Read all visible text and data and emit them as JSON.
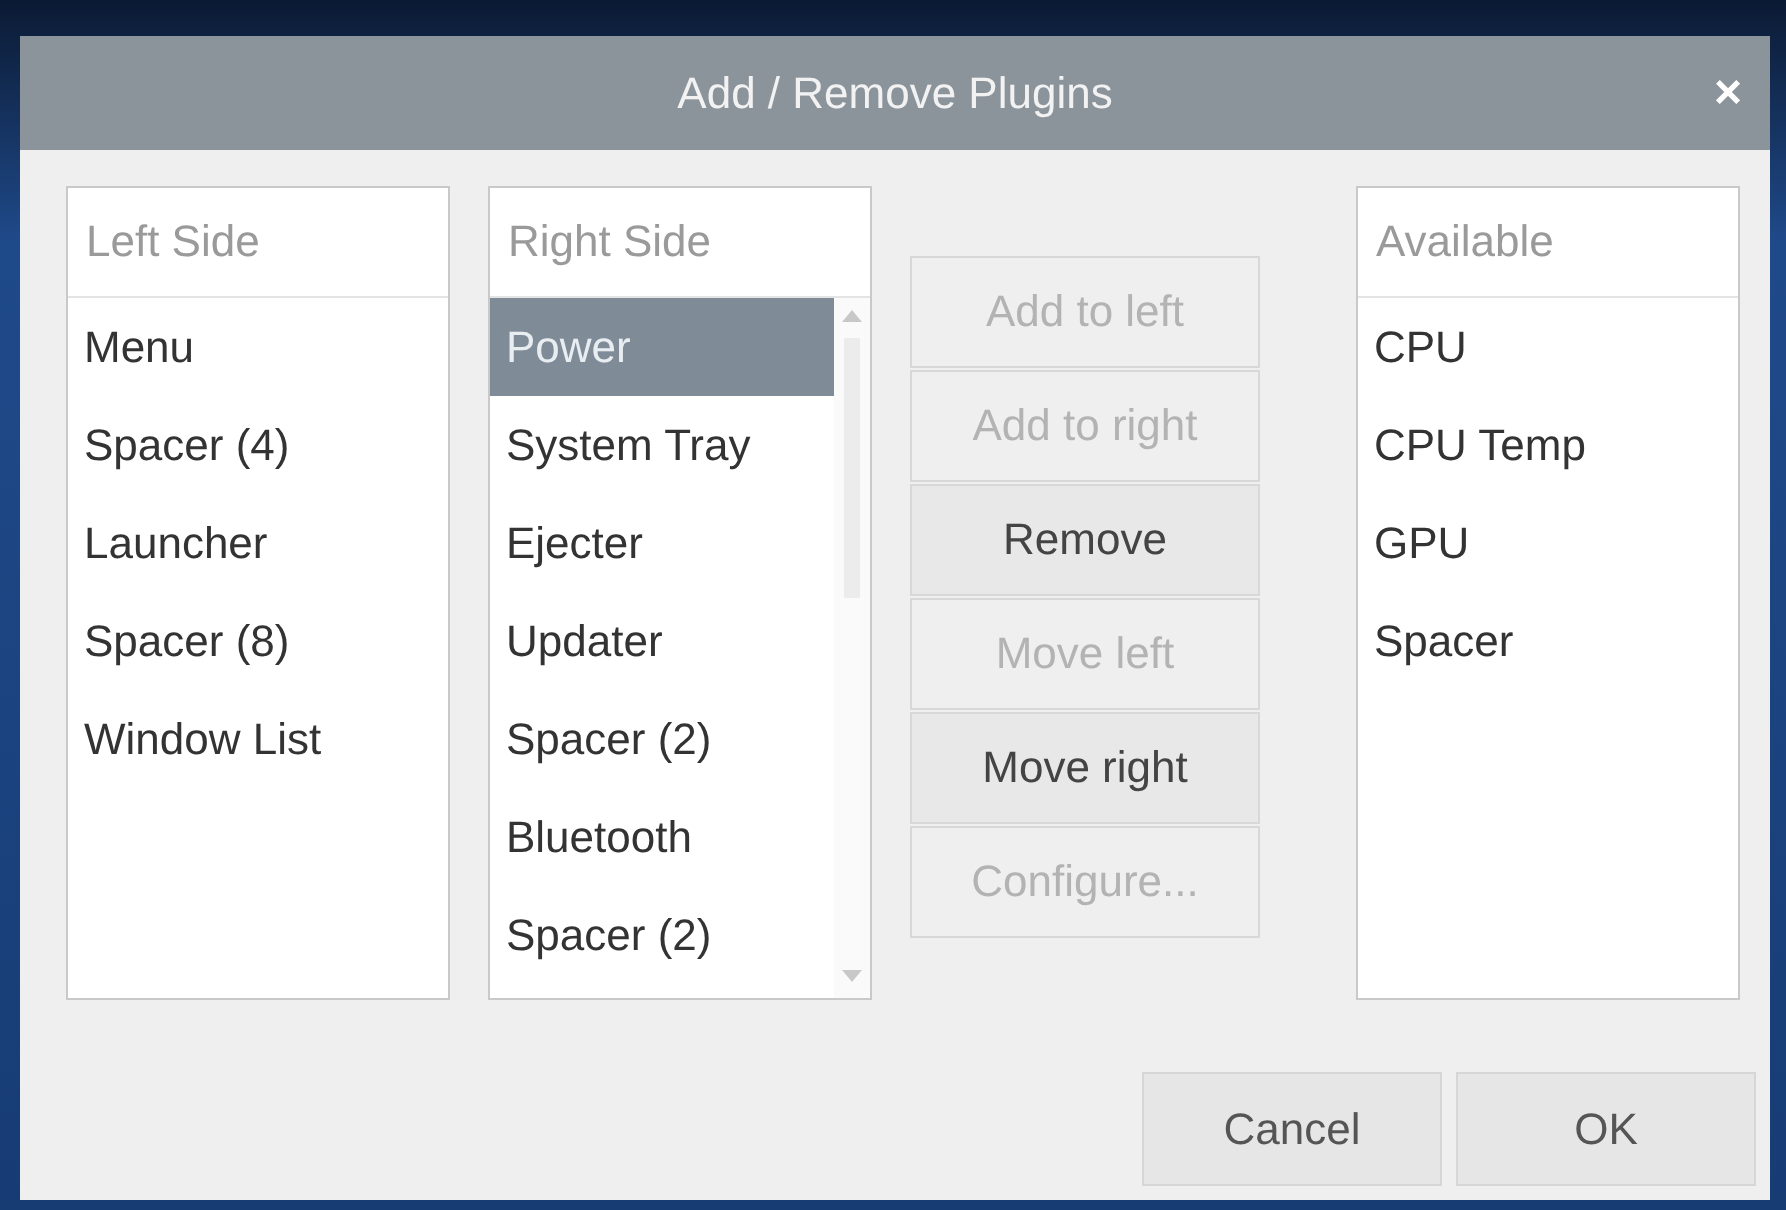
{
  "window": {
    "title": "Add / Remove Plugins",
    "close": "×"
  },
  "lists": [
    {
      "header": "Left Side",
      "scrollbar": false,
      "items": [
        {
          "label": "Menu",
          "selected": false
        },
        {
          "label": "Spacer (4)",
          "selected": false
        },
        {
          "label": "Launcher",
          "selected": false
        },
        {
          "label": "Spacer (8)",
          "selected": false
        },
        {
          "label": "Window List",
          "selected": false
        }
      ]
    },
    {
      "header": "Right Side",
      "scrollbar": true,
      "items": [
        {
          "label": "Power",
          "selected": true
        },
        {
          "label": "System Tray",
          "selected": false
        },
        {
          "label": "Ejecter",
          "selected": false
        },
        {
          "label": "Updater",
          "selected": false
        },
        {
          "label": "Spacer (2)",
          "selected": false
        },
        {
          "label": "Bluetooth",
          "selected": false
        },
        {
          "label": "Spacer (2)",
          "selected": false
        }
      ]
    },
    {
      "header": "Available",
      "scrollbar": false,
      "items": [
        {
          "label": "CPU",
          "selected": false
        },
        {
          "label": "CPU Temp",
          "selected": false
        },
        {
          "label": "GPU",
          "selected": false
        },
        {
          "label": "Spacer",
          "selected": false
        }
      ]
    }
  ],
  "actions": [
    {
      "label": "Add to left",
      "disabled": true
    },
    {
      "label": "Add to right",
      "disabled": true
    },
    {
      "label": "Remove",
      "disabled": false
    },
    {
      "label": "Move left",
      "disabled": true
    },
    {
      "label": "Move right",
      "disabled": false
    },
    {
      "label": "Configure...",
      "disabled": true
    }
  ],
  "buttons": [
    "Cancel",
    "OK"
  ]
}
